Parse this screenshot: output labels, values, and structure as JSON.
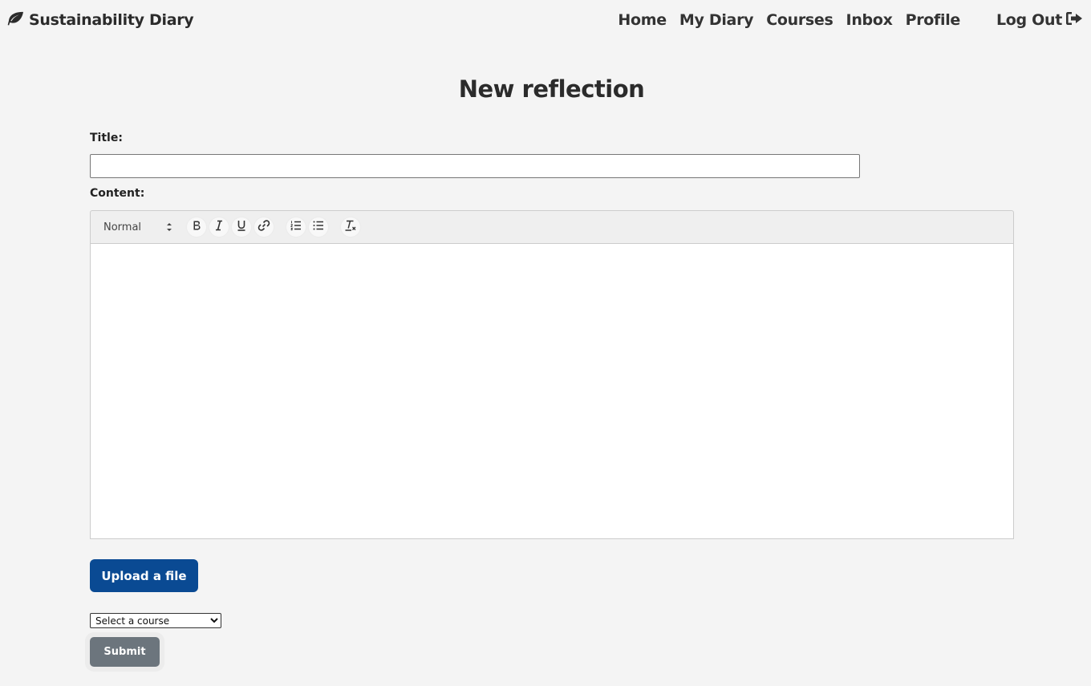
{
  "brand": {
    "name": "Sustainability Diary",
    "icon": "leaf-icon"
  },
  "nav": {
    "links": [
      "Home",
      "My Diary",
      "Courses",
      "Inbox",
      "Profile"
    ],
    "logout_label": "Log Out",
    "logout_icon": "sign-out-icon"
  },
  "page": {
    "title": "New reflection",
    "title_label": "Title:",
    "title_value": "",
    "content_label": "Content:"
  },
  "editor": {
    "format_selected": "Normal",
    "tools": [
      "bold-icon",
      "italic-icon",
      "underline-icon",
      "link-icon",
      "ordered-list-icon",
      "bullet-list-icon",
      "clean-format-icon"
    ]
  },
  "actions": {
    "upload_label": "Upload a file",
    "course_select_selected": "Select a course",
    "submit_label": "Submit"
  },
  "colors": {
    "background": "#f4f4f4",
    "upload_button": "#0a4a93",
    "submit_button": "#6c757d"
  }
}
